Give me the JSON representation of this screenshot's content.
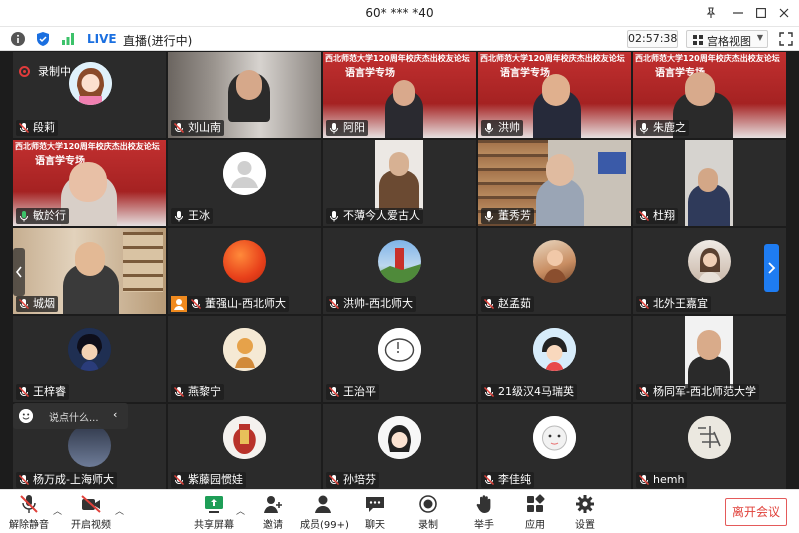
{
  "window": {
    "title": "60* *** *40"
  },
  "infobar": {
    "live_badge": "LIVE",
    "live_status": "直播(进行中)",
    "timer": "02:57:38",
    "grid_view_label": "宫格视图"
  },
  "recording_label": "录制中",
  "banner": {
    "line1": "西北师范大学120周年校庆杰出校友论坛",
    "line2": "语言学专场"
  },
  "participants": [
    {
      "name": "段莉",
      "mic": "muted"
    },
    {
      "name": "刘山南",
      "mic": "muted"
    },
    {
      "name": "阿阳",
      "mic": "on"
    },
    {
      "name": "洪帅",
      "mic": "on"
    },
    {
      "name": "朱鹿之",
      "mic": "on"
    },
    {
      "name": "敏於行",
      "mic": "speaking"
    },
    {
      "name": "王冰",
      "mic": "on"
    },
    {
      "name": "不薄今人爱古人",
      "mic": "on"
    },
    {
      "name": "董秀芳",
      "mic": "on"
    },
    {
      "name": "杜翔",
      "mic": "muted"
    },
    {
      "name": "城烟",
      "mic": "muted"
    },
    {
      "name": "董强山-西北师大",
      "mic": "muted"
    },
    {
      "name": "洪帅-西北师大",
      "mic": "muted"
    },
    {
      "name": "赵孟茹",
      "mic": "muted"
    },
    {
      "name": "北外王嘉宜",
      "mic": "muted"
    },
    {
      "name": "王梓睿",
      "mic": "muted"
    },
    {
      "name": "燕黎宁",
      "mic": "muted"
    },
    {
      "name": "王治平",
      "mic": "muted"
    },
    {
      "name": "21级汉4马瑞英",
      "mic": "muted"
    },
    {
      "name": "杨同军-西北师范大学",
      "mic": "muted"
    },
    {
      "name": "杨万成-上海师大",
      "mic": "muted"
    },
    {
      "name": "紫藤园惯娃",
      "mic": "muted"
    },
    {
      "name": "孙培芬",
      "mic": "muted"
    },
    {
      "name": "李佳纯",
      "mic": "muted"
    },
    {
      "name": "hemh",
      "mic": "muted"
    }
  ],
  "chat_popup": {
    "placeholder": "说点什么..."
  },
  "toolbar": {
    "unmute": "解除静音",
    "start_video": "开启视频",
    "share_screen": "共享屏幕",
    "invite": "邀请",
    "members": "成员(99+)",
    "chat": "聊天",
    "record": "录制",
    "raise_hand": "举手",
    "apps": "应用",
    "settings": "设置",
    "leave": "离开会议"
  },
  "colors": {
    "accent_blue": "#1a6fe0",
    "muted_red": "#e0413a",
    "speaking_green": "#3cc26a",
    "tile_bg": "#2b2b2b",
    "side_arrow_blue": "#1e7cf2"
  }
}
